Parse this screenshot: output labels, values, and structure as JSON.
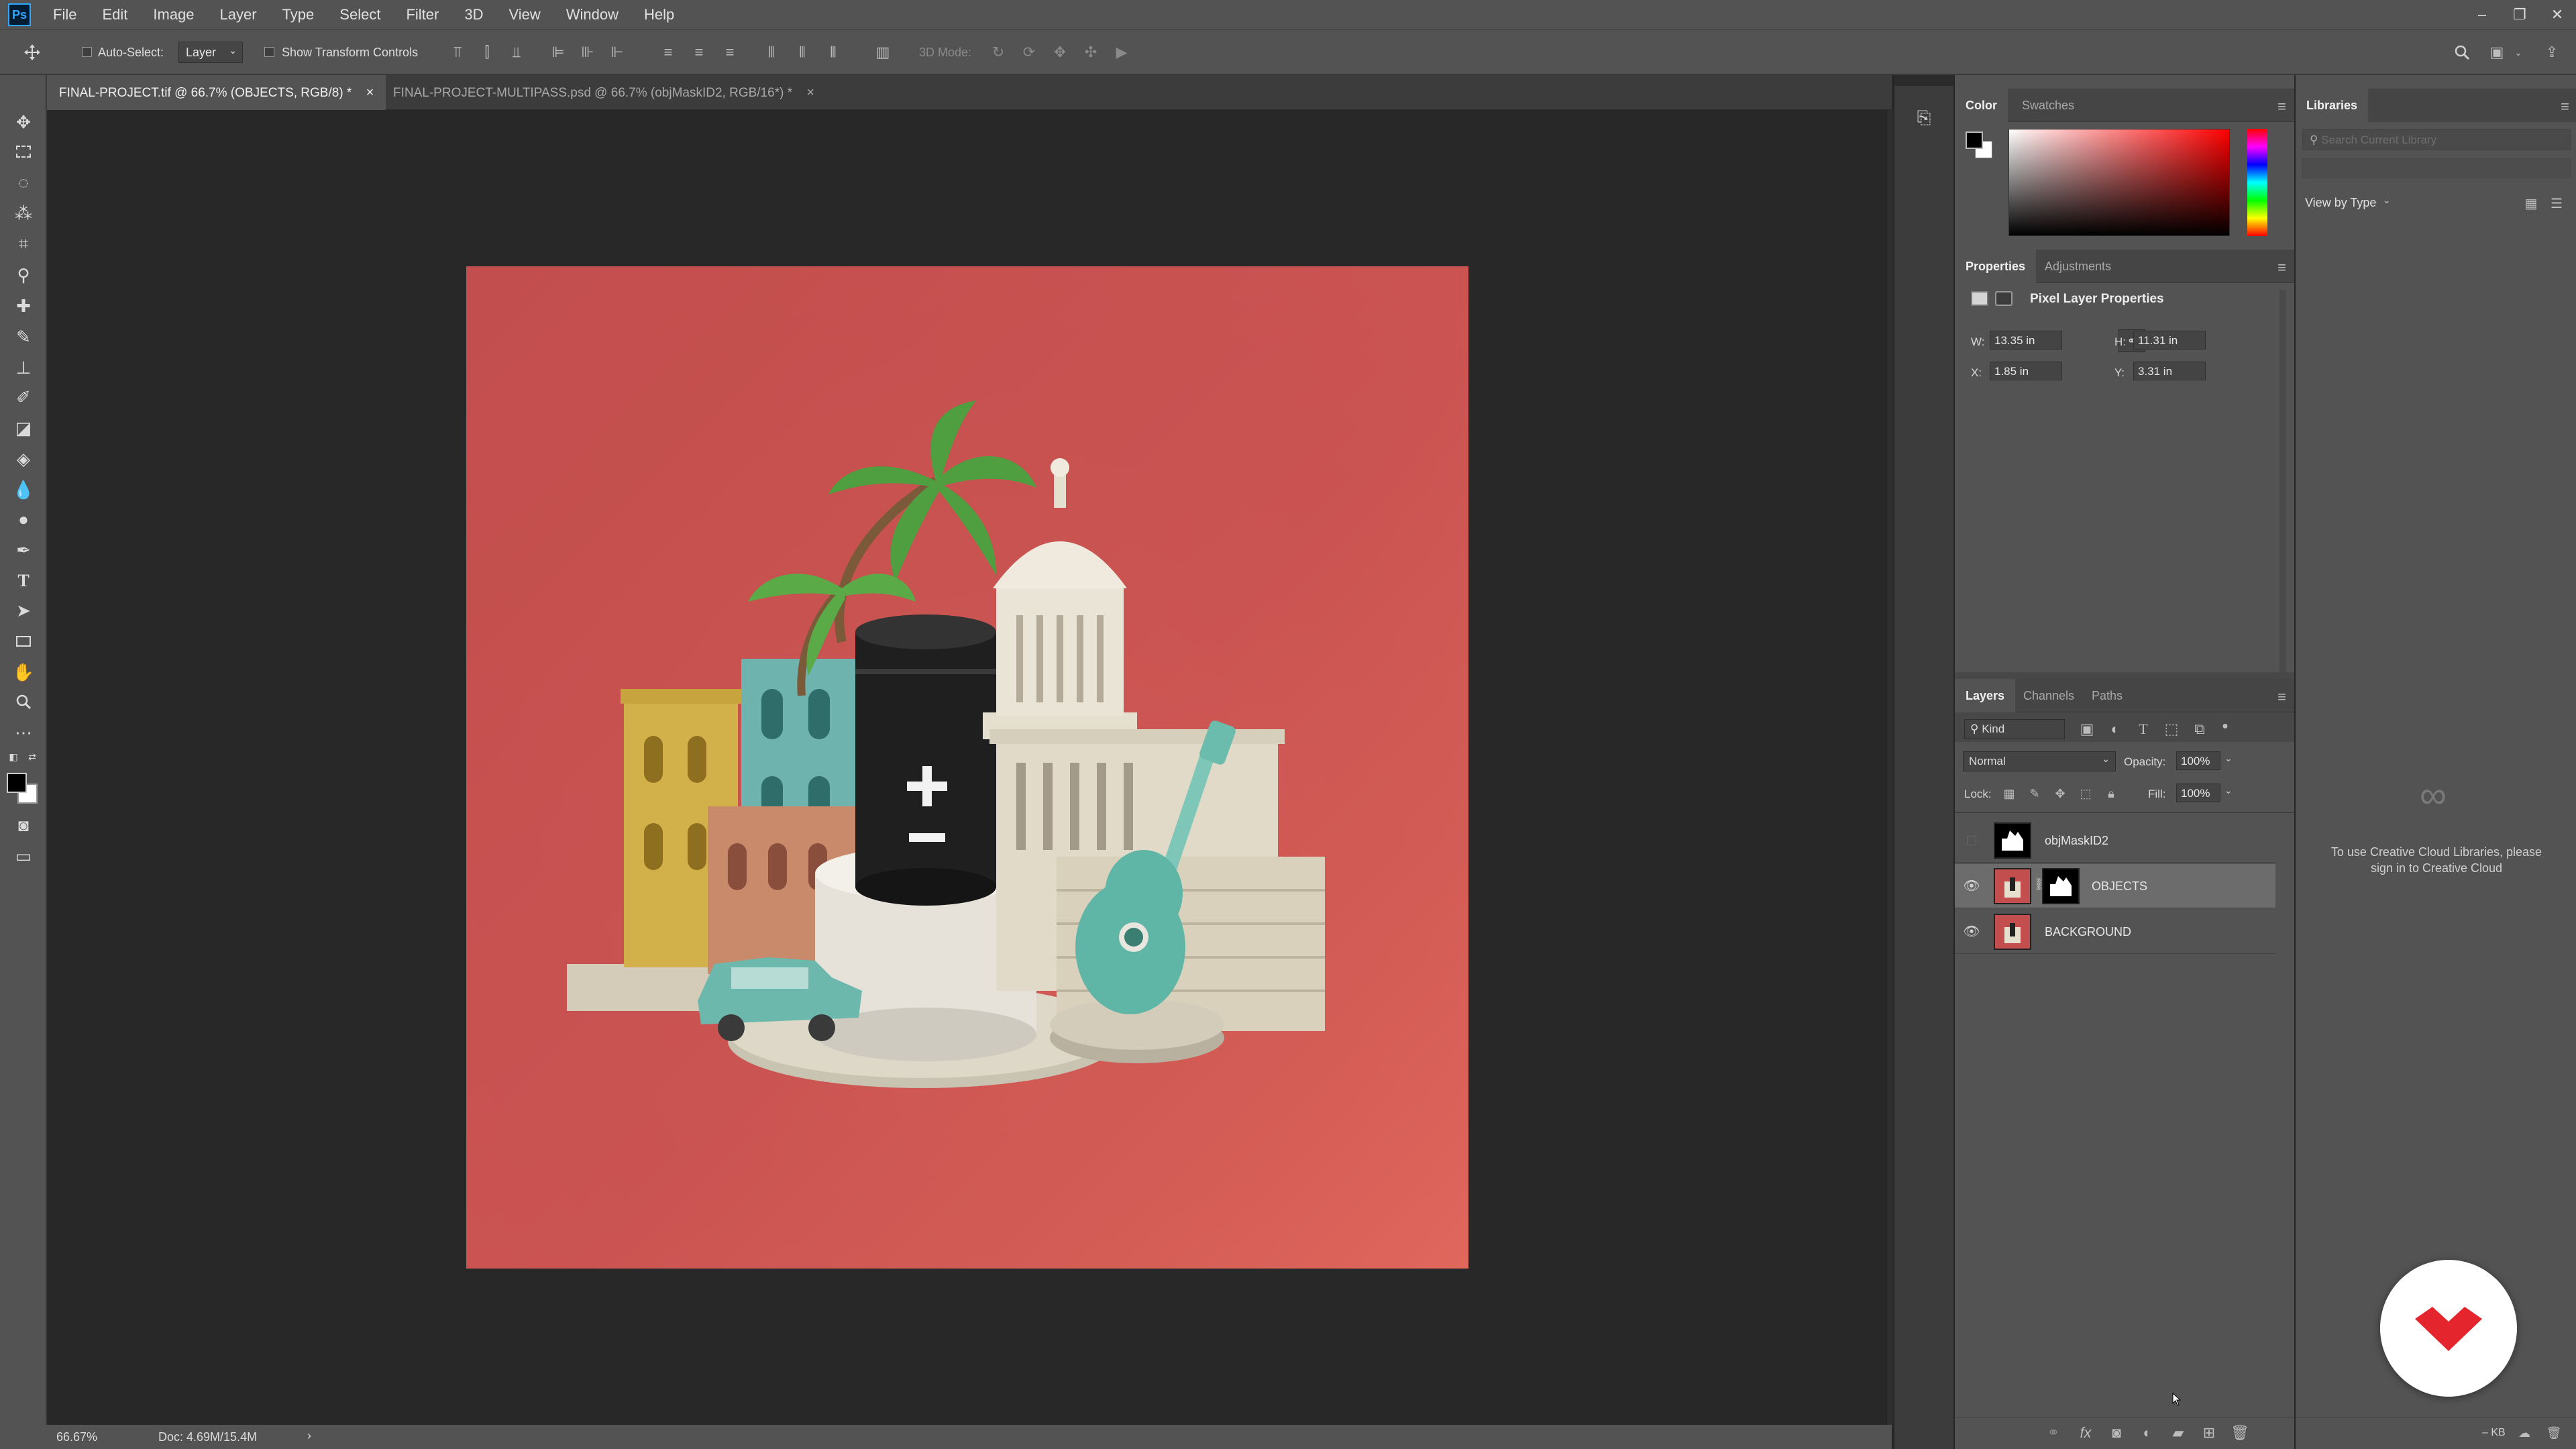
{
  "app": {
    "logo_text": "Ps",
    "menu": [
      "File",
      "Edit",
      "Image",
      "Layer",
      "Type",
      "Select",
      "Filter",
      "3D",
      "View",
      "Window",
      "Help"
    ],
    "window_controls": [
      "–",
      "❐",
      "✕"
    ]
  },
  "options_bar": {
    "auto_select_label": "Auto-Select:",
    "auto_select_value": "Layer",
    "show_transform_label": "Show Transform Controls",
    "mode_3d_label": "3D Mode:"
  },
  "tabs": [
    {
      "label": "FINAL-PROJECT.tif @ 66.7% (OBJECTS, RGB/8) *",
      "active": true
    },
    {
      "label": "FINAL-PROJECT-MULTIPASS.psd @ 66.7% (objMaskID2, RGB/16*) *",
      "active": false
    }
  ],
  "status": {
    "zoom": "66.67%",
    "doc": "Doc: 4.69M/15.4M",
    "arrow": "›"
  },
  "color_panel": {
    "tabs": [
      "Color",
      "Swatches"
    ],
    "foreground": "#000000",
    "background": "#ffffff",
    "hue": "#ff0000"
  },
  "properties_panel": {
    "tabs": [
      "Properties",
      "Adjustments"
    ],
    "title": "Pixel Layer Properties",
    "w_label": "W:",
    "w_value": "13.35 in",
    "h_label": "H:",
    "h_value": "11.31 in",
    "x_label": "X:",
    "x_value": "1.85 in",
    "y_label": "Y:",
    "y_value": "3.31 in"
  },
  "layers_panel": {
    "tabs": [
      "Layers",
      "Channels",
      "Paths"
    ],
    "kind_label": "Kind",
    "blend_mode": "Normal",
    "opacity_label": "Opacity:",
    "opacity_value": "100%",
    "lock_label": "Lock:",
    "fill_label": "Fill:",
    "fill_value": "100%",
    "layers": [
      {
        "name": "objMaskID2",
        "visible": false,
        "selected": false
      },
      {
        "name": "OBJECTS",
        "visible": true,
        "selected": true
      },
      {
        "name": "BACKGROUND",
        "visible": true,
        "selected": false
      }
    ]
  },
  "libraries_panel": {
    "title": "Libraries",
    "search_placeholder": "Search Current Library",
    "view_by": "View by Type",
    "signin_message": "To use Creative Cloud Libraries, please sign in to Creative Cloud",
    "footer_size": "– KB"
  },
  "colors": {
    "ui_panel": "#535353",
    "ui_dark": "#282828",
    "canvas_bg": "#c24e4d",
    "accent": "#31a8ff",
    "brand": "#e4252d"
  }
}
